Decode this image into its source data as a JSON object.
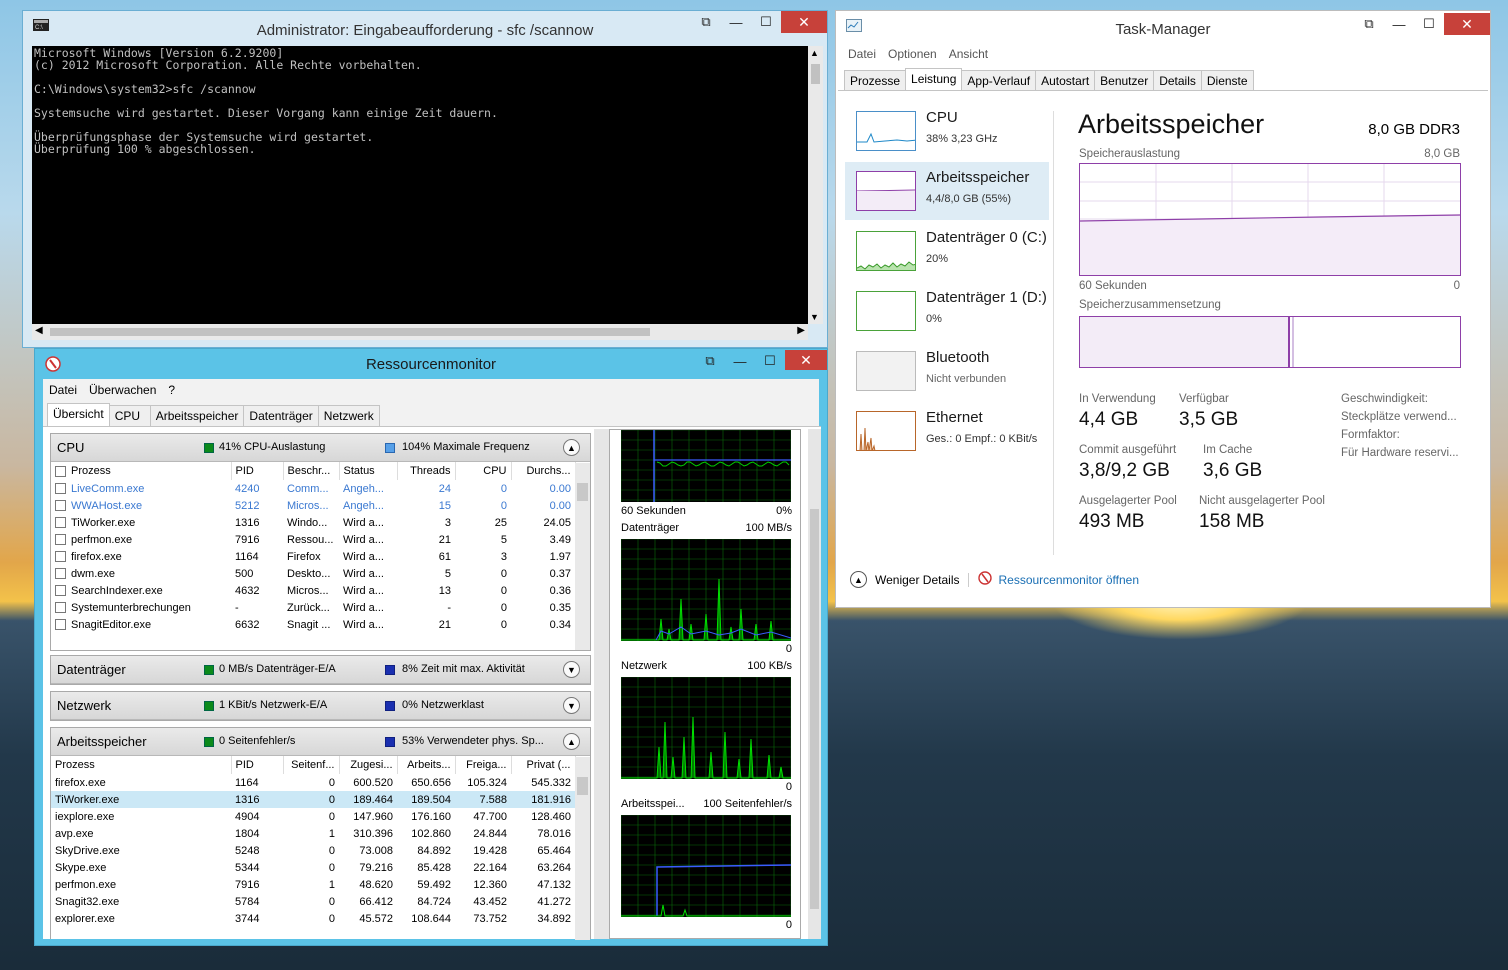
{
  "cmd": {
    "title": "Administrator: Eingabeaufforderung - sfc  /scannow",
    "lines": [
      "Microsoft Windows [Version 6.2.9200]",
      "(c) 2012 Microsoft Corporation. Alle Rechte vorbehalten.",
      "",
      "C:\\Windows\\system32>sfc /scannow",
      "",
      "Systemsuche wird gestartet. Dieser Vorgang kann einige Zeit dauern.",
      "",
      "Überprüfungsphase der Systemsuche wird gestartet.",
      "Überprüfung 100 % abgeschlossen."
    ]
  },
  "rm": {
    "title": "Ressourcenmonitor",
    "menu": [
      "Datei",
      "Überwachen",
      "?"
    ],
    "tabs": [
      "Übersicht",
      "CPU",
      "Arbeitsspeicher",
      "Datenträger",
      "Netzwerk"
    ],
    "cpu": {
      "title": "CPU",
      "stat1": "41% CPU-Auslastung",
      "stat2": "104% Maximale Frequenz",
      "cols": [
        "Prozess",
        "PID",
        "Beschr...",
        "Status",
        "Threads",
        "CPU",
        "Durchs..."
      ],
      "rows": [
        [
          "LiveComm.exe",
          "4240",
          "Comm...",
          "Angeh...",
          "24",
          "0",
          "0.00"
        ],
        [
          "WWAHost.exe",
          "5212",
          "Micros...",
          "Angeh...",
          "15",
          "0",
          "0.00"
        ],
        [
          "TiWorker.exe",
          "1316",
          "Windo...",
          "Wird a...",
          "3",
          "25",
          "24.05"
        ],
        [
          "perfmon.exe",
          "7916",
          "Ressou...",
          "Wird a...",
          "21",
          "5",
          "3.49"
        ],
        [
          "firefox.exe",
          "1164",
          "Firefox",
          "Wird a...",
          "61",
          "3",
          "1.97"
        ],
        [
          "dwm.exe",
          "500",
          "Deskto...",
          "Wird a...",
          "5",
          "0",
          "0.37"
        ],
        [
          "SearchIndexer.exe",
          "4632",
          "Micros...",
          "Wird a...",
          "13",
          "0",
          "0.36"
        ],
        [
          "Systemunterbrechungen",
          "-",
          "Zurück...",
          "Wird a...",
          "-",
          "0",
          "0.35"
        ],
        [
          "SnagitEditor.exe",
          "6632",
          "Snagit ...",
          "Wird a...",
          "21",
          "0",
          "0.34"
        ]
      ]
    },
    "disk": {
      "title": "Datenträger",
      "stat1": "0 MB/s Datenträger-E/A",
      "stat2": "8% Zeit mit max. Aktivität"
    },
    "net": {
      "title": "Netzwerk",
      "stat1": "1 KBit/s Netzwerk-E/A",
      "stat2": "0% Netzwerklast"
    },
    "mem": {
      "title": "Arbeitsspeicher",
      "stat1": "0 Seitenfehler/s",
      "stat2": "53% Verwendeter phys. Sp...",
      "cols": [
        "Prozess",
        "PID",
        "Seitenf...",
        "Zugesi...",
        "Arbeits...",
        "Freiga...",
        "Privat (..."
      ],
      "rows": [
        [
          "firefox.exe",
          "1164",
          "0",
          "600.520",
          "650.656",
          "105.324",
          "545.332"
        ],
        [
          "TiWorker.exe",
          "1316",
          "0",
          "189.464",
          "189.504",
          "7.588",
          "181.916"
        ],
        [
          "iexplore.exe",
          "4904",
          "0",
          "147.960",
          "176.160",
          "47.700",
          "128.460"
        ],
        [
          "avp.exe",
          "1804",
          "1",
          "310.396",
          "102.860",
          "24.844",
          "78.016"
        ],
        [
          "SkyDrive.exe",
          "5248",
          "0",
          "73.008",
          "84.892",
          "19.428",
          "65.464"
        ],
        [
          "Skype.exe",
          "5344",
          "0",
          "79.216",
          "85.428",
          "22.164",
          "63.264"
        ],
        [
          "perfmon.exe",
          "7916",
          "1",
          "48.620",
          "59.492",
          "12.360",
          "47.132"
        ],
        [
          "Snagit32.exe",
          "5784",
          "0",
          "66.412",
          "84.724",
          "43.452",
          "41.272"
        ],
        [
          "explorer.exe",
          "3744",
          "0",
          "45.572",
          "108.644",
          "73.752",
          "34.892"
        ]
      ]
    },
    "graphs": {
      "cpu_time": "60 Sekunden",
      "cpu_pct": "0%",
      "disk_label": "Datenträger",
      "disk_max": "100 MB/s",
      "disk_min": "0",
      "net_label": "Netzwerk",
      "net_max": "100 KB/s",
      "net_min": "0",
      "mem_label": "Arbeitsspei...",
      "mem_max": "100 Seitenfehler/s",
      "mem_min": "0"
    }
  },
  "tm": {
    "title": "Task-Manager",
    "menu": [
      "Datei",
      "Optionen",
      "Ansicht"
    ],
    "tabs": [
      "Prozesse",
      "Leistung",
      "App-Verlauf",
      "Autostart",
      "Benutzer",
      "Details",
      "Dienste"
    ],
    "side": [
      {
        "name": "CPU",
        "sub": "38% 3,23 GHz"
      },
      {
        "name": "Arbeitsspeicher",
        "sub": "4,4/8,0 GB (55%)"
      },
      {
        "name": "Datenträger 0 (C:)",
        "sub": "20%"
      },
      {
        "name": "Datenträger 1 (D:)",
        "sub": "0%"
      },
      {
        "name": "Bluetooth",
        "sub": "Nicht verbunden"
      },
      {
        "name": "Ethernet",
        "sub": "Ges.: 0 Empf.: 0 KBit/s"
      }
    ],
    "main": {
      "title": "Arbeitsspeicher",
      "spec": "8,0 GB DDR3",
      "usage_label": "Speicherauslastung",
      "usage_max": "8,0 GB",
      "time_label": "60 Sekunden",
      "time_end": "0",
      "comp_label": "Speicherzusammensetzung",
      "stats": [
        {
          "label": "In Verwendung",
          "value": "4,4 GB"
        },
        {
          "label": "Verfügbar",
          "value": "3,5 GB"
        },
        {
          "label": "Commit ausgeführt",
          "value": "3,8/9,2 GB"
        },
        {
          "label": "Im Cache",
          "value": "3,6 GB"
        },
        {
          "label": "Ausgelagerter Pool",
          "value": "493 MB"
        },
        {
          "label": "Nicht ausgelagerter Pool",
          "value": "158 MB"
        }
      ],
      "right_keys": [
        "Geschwindigkeit:",
        "Steckplätze verwend...",
        "Formfaktor:",
        "Für Hardware reservi..."
      ]
    },
    "footer": {
      "less": "Weniger Details",
      "open": "Ressourcenmonitor öffnen"
    }
  },
  "colors": {
    "accent": "#1e88c8",
    "memory_purple": "#8e3fa8",
    "graph_green": "#00c000",
    "close_red": "#c7413a"
  }
}
